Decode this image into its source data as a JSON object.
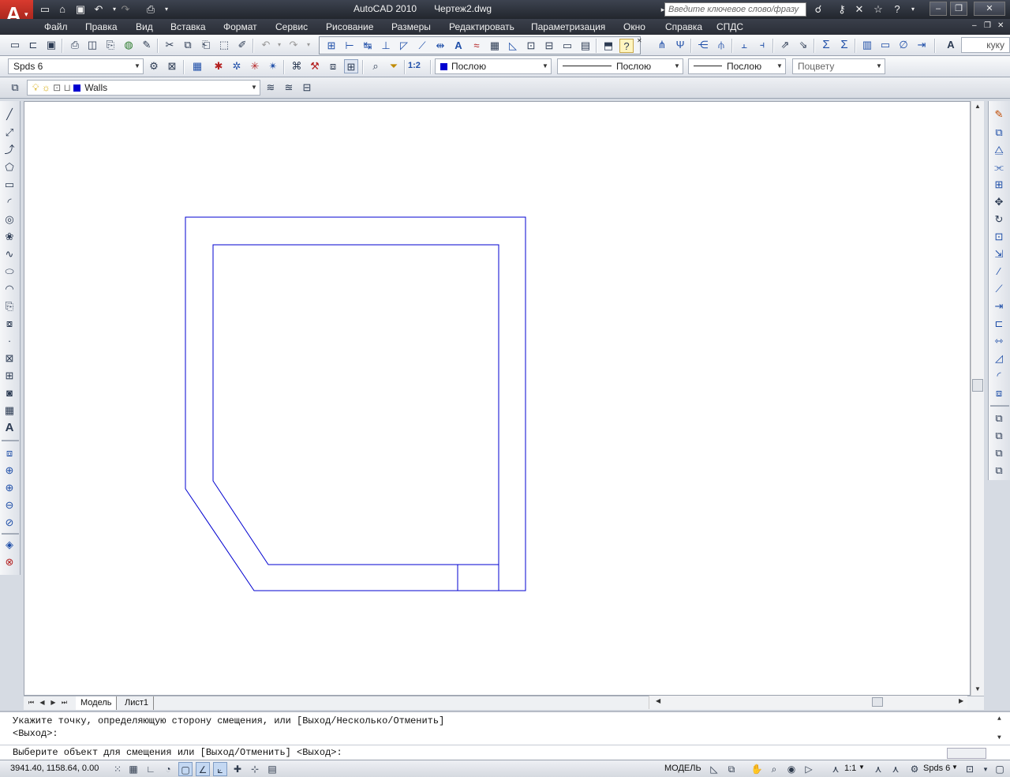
{
  "titlebar": {
    "app_name": "AutoCAD 2010",
    "document": "Чертеж2.dwg",
    "search_placeholder": "Введите ключевое слово/фразу"
  },
  "menus": [
    "Файл",
    "Правка",
    "Вид",
    "Вставка",
    "Формат",
    "Сервис",
    "Рисование",
    "Размеры",
    "Редактировать",
    "Параметризация",
    "Окно",
    "Справка",
    "СПДС"
  ],
  "toolbar_std": {
    "right_field": "куку"
  },
  "toolbar_props": {
    "annotation_style": "Spds 6",
    "scale_label": "1:2",
    "color": "Послою",
    "color_hex": "#0000d0",
    "linetype": "Послою",
    "lineweight": "Послою",
    "plotstyle": "Поцвету"
  },
  "layers": {
    "current_layer": "Walls",
    "layer_color_hex": "#0000d0"
  },
  "tabs": [
    "Модель",
    "Лист1"
  ],
  "command": {
    "history_1": "Укажите точку, определяющую сторону смещения, или [Выход/Несколько/Отменить]",
    "history_2": "<Выход>:",
    "prompt": "Выберите объект для смещения или [Выход/Отменить] <Выход>:"
  },
  "status": {
    "coordinates": "3941.40, 1158.64, 0.00",
    "space": "МОДЕЛЬ",
    "annotation_scale": "1:1",
    "workspace": "Spds 6"
  }
}
